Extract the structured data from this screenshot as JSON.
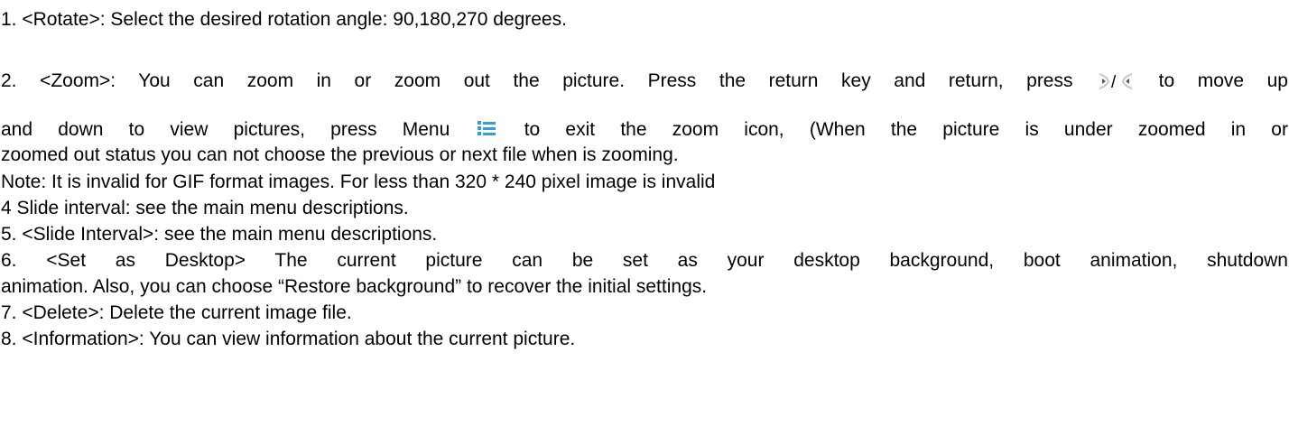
{
  "doc": {
    "items": {
      "rotate": "1. <Rotate>: Select the desired rotation angle: 90,180,270 degrees.",
      "zoom_part1": "2. <Zoom>: You can zoom in or zoom out the picture. Press the return key and return, press",
      "zoom_part2": "to move up",
      "zoom_line2_part1": "and down to view pictures,   press Menu",
      "zoom_line2_part2": "to exit the zoom icon, (When the picture is under zoomed in or",
      "zoom_line3": "zoomed out status you can not choose the previous or next file when is zooming.",
      "note": "Note: It is invalid for GIF format images. For less than 320 * 240 pixel image is invalid",
      "slide_interval_4": "4 Slide interval: see the main menu descriptions.",
      "slide_interval_5": "5. <Slide Interval>: see the main menu descriptions.",
      "desktop_line1": "6. <Set as Desktop> The current picture can be set as your desktop background, boot animation, shutdown",
      "desktop_line2": "animation. Also, you can choose “Restore background” to recover the initial settings.",
      "delete": "7. <Delete>: Delete the current image file.",
      "information": "8. <Information>: You can view information about the current picture."
    },
    "icons": {
      "arrow_pair": "left-right-arrow-icon",
      "menu": "menu-list-icon",
      "menu_color": "#2f9ee8"
    }
  }
}
